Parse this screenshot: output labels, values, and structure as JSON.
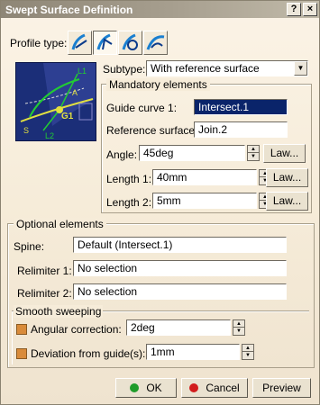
{
  "window": {
    "title": "Swept Surface Definition",
    "help_label": "?",
    "close_label": "×"
  },
  "profile": {
    "label": "Profile type:",
    "types": [
      "line",
      "circle",
      "conic",
      "explicit"
    ]
  },
  "preview": {
    "labels": {
      "l1": "L1",
      "a": "A",
      "g1": "G1",
      "s": "S",
      "l2": "L2"
    }
  },
  "subtype": {
    "label": "Subtype:",
    "value": "With reference surface"
  },
  "mandatory": {
    "title": "Mandatory elements",
    "guide_label": "Guide curve 1:",
    "guide_value": "Intersect.1",
    "ref_label": "Reference surface:",
    "ref_value": "Join.2",
    "angle_label": "Angle:",
    "angle_value": "45deg",
    "len1_label": "Length 1:",
    "len1_value": "40mm",
    "len2_label": "Length 2:",
    "len2_value": "5mm",
    "law_label": "Law..."
  },
  "optional": {
    "title": "Optional elements",
    "spine_label": "Spine:",
    "spine_value": "Default (Intersect.1)",
    "rel1_label": "Relimiter 1:",
    "rel1_value": "No selection",
    "rel2_label": "Relimiter 2:",
    "rel2_value": "No selection"
  },
  "smooth": {
    "title": "Smooth sweeping",
    "angular_label": "Angular correction:",
    "angular_value": "2deg",
    "deviation_label": "Deviation from guide(s):",
    "deviation_value": "1mm"
  },
  "buttons": {
    "ok": "OK",
    "cancel": "Cancel",
    "preview": "Preview"
  },
  "colors": {
    "accent": "#0a246a",
    "ok_dot": "#1f9c2a",
    "cancel_dot": "#d21c1c",
    "checkbox": "#d98b3a"
  }
}
